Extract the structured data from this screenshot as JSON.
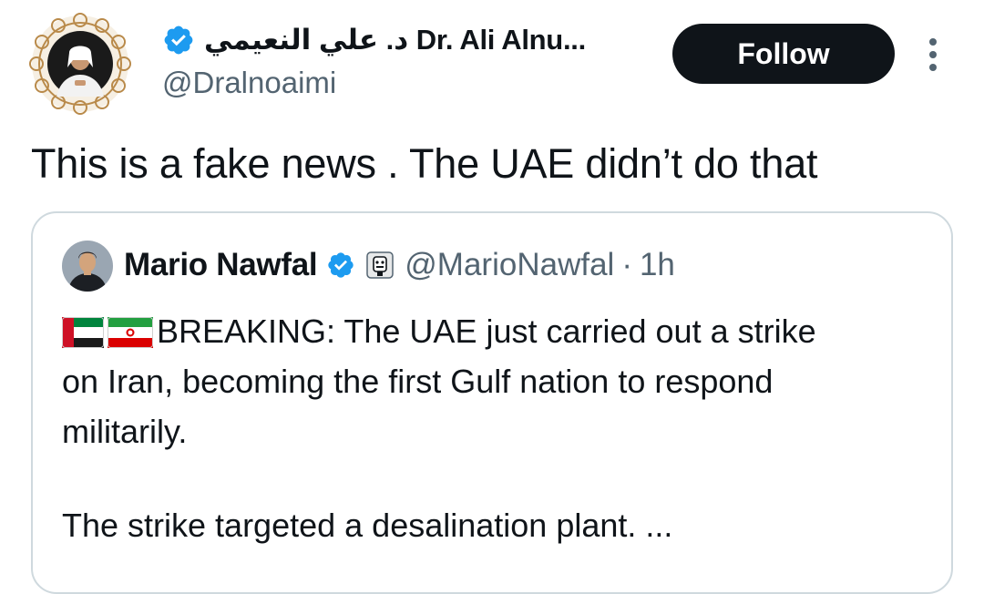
{
  "author": {
    "display_name": "د. علي النعيمي Dr. Ali Alnu...",
    "handle": "@Dralnoaimi",
    "verified_color": "#1d9bf0"
  },
  "actions": {
    "follow_label": "Follow"
  },
  "tweet": {
    "text": "This is a fake news . The UAE didn’t do that"
  },
  "quoted": {
    "display_name": "Mario Nawfal",
    "handle": "@MarioNawfal",
    "separator": "·",
    "time": "1h",
    "body_lines": [
      "BREAKING: The UAE just carried out a strike",
      "on Iran, becoming the first Gulf nation to respond",
      "militarily."
    ],
    "body_second_paragraph": "The strike targeted a desalination plant. ...",
    "flags": [
      "uae-flag-icon",
      "iran-flag-icon"
    ]
  },
  "colors": {
    "text_primary": "#0f1419",
    "text_secondary": "#536471",
    "border": "#cfd9de",
    "follow_bg": "#0f1419"
  }
}
